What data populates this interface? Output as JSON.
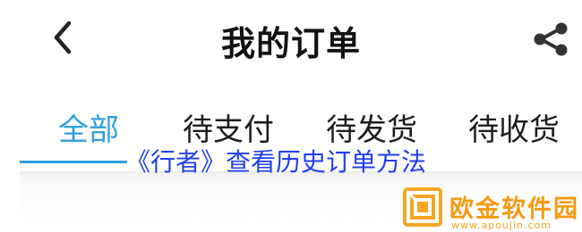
{
  "header": {
    "title": "我的订单",
    "back_icon": "chevron-left-icon",
    "share_icon": "share-icon"
  },
  "tabs": [
    {
      "label": "全部",
      "active": true
    },
    {
      "label": "待支付",
      "active": false
    },
    {
      "label": "待发货",
      "active": false
    },
    {
      "label": "待收货",
      "active": false
    }
  ],
  "overlay": {
    "caption": "《行者》查看历史订单方法"
  },
  "watermark": {
    "name": "欧金软件园",
    "url": "www.apoujin.com"
  },
  "colors": {
    "accent": "#2f9fdc",
    "caption": "#1f3ef0",
    "watermark": "#f29b12"
  }
}
